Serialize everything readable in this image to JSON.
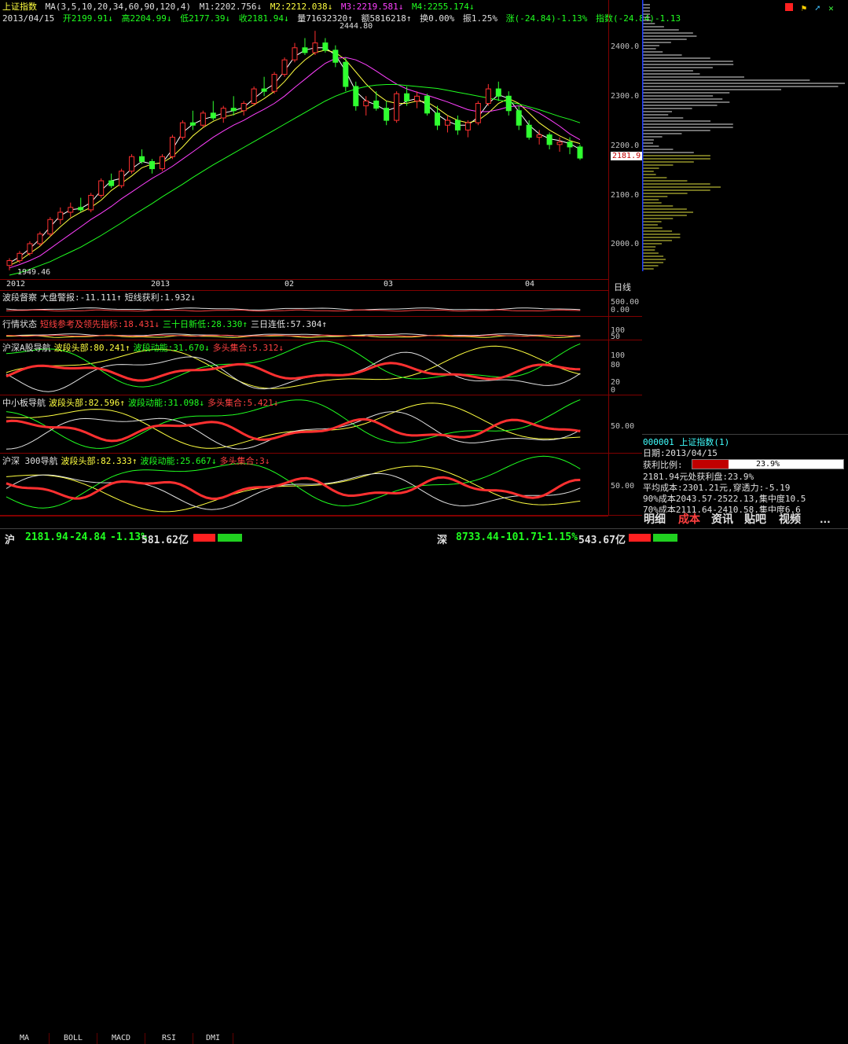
{
  "header": {
    "index_name": "上证指数",
    "ma_label": "MA(3,5,10,20,34,60,90,120,4)",
    "m1": "M1:2202.756↓",
    "m2": "M2:2212.038↓",
    "m3": "M3:2219.581↓",
    "m4": "M4:2255.174↓",
    "date": "2013/04/15",
    "open": "开2199.91↓",
    "high": "高2204.99↓",
    "low": "低2177.39↓",
    "close": "收2181.94↓",
    "volume": "量71632320↑",
    "amount": "额5816218↑",
    "turnover": "换0.00%",
    "amplitude": "振1.25%",
    "change": "涨(-24.84)-1.13%",
    "index_change": "指数(-24.84)-1.13"
  },
  "main_chart": {
    "high_label": "2444.80",
    "low_label": "1949.46",
    "price_ticks": [
      "2400.0",
      "2300.0",
      "2200.0",
      "2100.0",
      "2000.0"
    ],
    "current_price": "2181.9",
    "x_labels": [
      "2012",
      "2013",
      "02",
      "03",
      "04"
    ],
    "period": "日线"
  },
  "chart_data": {
    "type": "candlestick",
    "ylim": [
      1940,
      2460
    ],
    "ohlc": [
      [
        1960,
        1975,
        1950,
        1970
      ],
      [
        1970,
        1990,
        1965,
        1985
      ],
      [
        1985,
        2010,
        1980,
        2005
      ],
      [
        2005,
        2030,
        2000,
        2025
      ],
      [
        2025,
        2060,
        2020,
        2055
      ],
      [
        2055,
        2080,
        2045,
        2070
      ],
      [
        2070,
        2090,
        2060,
        2080
      ],
      [
        2080,
        2100,
        2070,
        2075
      ],
      [
        2075,
        2110,
        2070,
        2105
      ],
      [
        2105,
        2140,
        2100,
        2135
      ],
      [
        2135,
        2150,
        2120,
        2125
      ],
      [
        2125,
        2160,
        2120,
        2155
      ],
      [
        2155,
        2190,
        2150,
        2185
      ],
      [
        2185,
        2200,
        2170,
        2175
      ],
      [
        2175,
        2180,
        2150,
        2160
      ],
      [
        2160,
        2190,
        2155,
        2185
      ],
      [
        2185,
        2230,
        2180,
        2225
      ],
      [
        2225,
        2260,
        2220,
        2255
      ],
      [
        2255,
        2280,
        2240,
        2250
      ],
      [
        2250,
        2280,
        2245,
        2275
      ],
      [
        2275,
        2300,
        2260,
        2265
      ],
      [
        2265,
        2290,
        2255,
        2285
      ],
      [
        2285,
        2310,
        2270,
        2280
      ],
      [
        2280,
        2300,
        2270,
        2295
      ],
      [
        2295,
        2330,
        2290,
        2325
      ],
      [
        2325,
        2350,
        2310,
        2320
      ],
      [
        2320,
        2360,
        2315,
        2355
      ],
      [
        2355,
        2390,
        2350,
        2385
      ],
      [
        2385,
        2420,
        2380,
        2410
      ],
      [
        2410,
        2430,
        2395,
        2400
      ],
      [
        2400,
        2445,
        2395,
        2420
      ],
      [
        2420,
        2430,
        2400,
        2405
      ],
      [
        2405,
        2415,
        2370,
        2380
      ],
      [
        2380,
        2390,
        2320,
        2330
      ],
      [
        2330,
        2340,
        2280,
        2290
      ],
      [
        2290,
        2310,
        2270,
        2300
      ],
      [
        2300,
        2320,
        2280,
        2285
      ],
      [
        2285,
        2300,
        2250,
        2260
      ],
      [
        2260,
        2320,
        2255,
        2315
      ],
      [
        2315,
        2330,
        2290,
        2300
      ],
      [
        2300,
        2320,
        2285,
        2310
      ],
      [
        2310,
        2315,
        2270,
        2275
      ],
      [
        2275,
        2290,
        2240,
        2250
      ],
      [
        2250,
        2270,
        2235,
        2260
      ],
      [
        2260,
        2270,
        2230,
        2240
      ],
      [
        2240,
        2260,
        2225,
        2255
      ],
      [
        2255,
        2300,
        2250,
        2295
      ],
      [
        2295,
        2335,
        2290,
        2325
      ],
      [
        2325,
        2340,
        2300,
        2310
      ],
      [
        2310,
        2320,
        2270,
        2280
      ],
      [
        2280,
        2290,
        2240,
        2250
      ],
      [
        2250,
        2260,
        2220,
        2225
      ],
      [
        2225,
        2240,
        2210,
        2230
      ],
      [
        2230,
        2235,
        2200,
        2210
      ],
      [
        2210,
        2225,
        2195,
        2215
      ],
      [
        2215,
        2225,
        2190,
        2205
      ],
      [
        2205,
        2210,
        2178,
        2182
      ]
    ],
    "ma_lines": [
      {
        "name": "M1",
        "color": "#ffffff",
        "values": [
          1965,
          1978,
          1995,
          2015,
          2040,
          2063,
          2075,
          2078,
          2090,
          2115,
          2135,
          2140,
          2160,
          2175,
          2170,
          2172,
          2200,
          2235,
          2252,
          2262,
          2268,
          2275,
          2280,
          2287,
          2305,
          2322,
          2335,
          2362,
          2392,
          2405,
          2410,
          2410,
          2395,
          2362,
          2320,
          2300,
          2292,
          2280,
          2287,
          2300,
          2305,
          2292,
          2272,
          2258,
          2250,
          2250,
          2267,
          2295,
          2313,
          2305,
          2278,
          2250,
          2232,
          2222,
          2218,
          2212,
          2200
        ]
      },
      {
        "name": "M2",
        "color": "#ffff40",
        "values": [
          1960,
          1970,
          1985,
          2000,
          2020,
          2040,
          2058,
          2070,
          2080,
          2095,
          2115,
          2130,
          2145,
          2162,
          2170,
          2172,
          2185,
          2205,
          2228,
          2245,
          2258,
          2267,
          2272,
          2280,
          2292,
          2305,
          2320,
          2340,
          2365,
          2385,
          2400,
          2405,
          2400,
          2385,
          2360,
          2335,
          2315,
          2300,
          2295,
          2295,
          2300,
          2298,
          2285,
          2270,
          2260,
          2255,
          2260,
          2275,
          2295,
          2305,
          2295,
          2275,
          2255,
          2240,
          2228,
          2218,
          2212
        ]
      },
      {
        "name": "M3",
        "color": "#ff40ff",
        "values": [
          1955,
          1962,
          1970,
          1980,
          1995,
          2010,
          2025,
          2040,
          2055,
          2068,
          2082,
          2098,
          2112,
          2126,
          2140,
          2152,
          2165,
          2180,
          2195,
          2210,
          2225,
          2238,
          2250,
          2260,
          2272,
          2283,
          2295,
          2310,
          2328,
          2345,
          2362,
          2378,
          2388,
          2390,
          2385,
          2375,
          2362,
          2348,
          2335,
          2325,
          2318,
          2312,
          2305,
          2298,
          2290,
          2282,
          2278,
          2278,
          2282,
          2288,
          2290,
          2285,
          2275,
          2262,
          2248,
          2232,
          2220
        ]
      },
      {
        "name": "M4",
        "color": "#20ff20",
        "values": [
          1940,
          1945,
          1952,
          1960,
          1968,
          1978,
          1988,
          1998,
          2010,
          2022,
          2035,
          2048,
          2062,
          2075,
          2088,
          2102,
          2115,
          2128,
          2142,
          2155,
          2168,
          2180,
          2192,
          2204,
          2216,
          2228,
          2240,
          2252,
          2264,
          2276,
          2288,
          2300,
          2310,
          2318,
          2325,
          2330,
          2333,
          2334,
          2334,
          2332,
          2330,
          2328,
          2326,
          2322,
          2318,
          2314,
          2310,
          2306,
          2302,
          2298,
          2294,
          2288,
          2282,
          2275,
          2268,
          2262,
          2255
        ]
      }
    ]
  },
  "sub_panels": [
    {
      "title": "波段督察",
      "items": [
        {
          "text": "大盘警报:-11.111↑",
          "color": "#e0e0e0"
        },
        {
          "text": "短线获利:1.932↓",
          "color": "#e0e0e0"
        }
      ],
      "ticks": [
        "500.00",
        "0.00"
      ]
    },
    {
      "title": "行情状态",
      "items": [
        {
          "text": "短线参考及领先指标:18.431↓",
          "color": "#ff4040"
        },
        {
          "text": "三十日新低:28.330↑",
          "color": "#20ff20"
        },
        {
          "text": "三日连低:57.304↑",
          "color": "#e0e0e0"
        }
      ],
      "ticks": [
        "100",
        "50"
      ]
    },
    {
      "title": "沪深A股导航",
      "items": [
        {
          "text": "波段头部:80.241↑",
          "color": "#ffff40"
        },
        {
          "text": "波段动能:31.670↓",
          "color": "#20ff20"
        },
        {
          "text": "多头集合:5.312↓",
          "color": "#ff4040"
        }
      ],
      "ticks": [
        "100",
        "80",
        "20",
        "0"
      ]
    },
    {
      "title": "中小板导航",
      "items": [
        {
          "text": "波段头部:82.596↑",
          "color": "#ffff40"
        },
        {
          "text": "波段动能:31.098↓",
          "color": "#20ff20"
        },
        {
          "text": "多头集合:5.421↓",
          "color": "#ff4040"
        }
      ],
      "ticks": [
        "50.00"
      ]
    },
    {
      "title": "沪深 300导航",
      "items": [
        {
          "text": "波段头部:82.333↑",
          "color": "#ffff40"
        },
        {
          "text": "波段动能:25.667↓",
          "color": "#20ff20"
        },
        {
          "text": "多头集合:3↓",
          "color": "#ff4040"
        }
      ],
      "ticks": [
        "50.00"
      ]
    }
  ],
  "bottom_tabs": [
    "MA",
    "BOLL",
    "MACD",
    "RSI",
    "DMI"
  ],
  "right_panel": {
    "code_line": "000001 上证指数(1)",
    "date_line": "日期:2013/04/15",
    "profit_ratio_label": "获利比例:",
    "profit_ratio_value": "23.9%",
    "profit_fraction": 0.239,
    "line1": "2181.94元处获利盘:23.9%",
    "line2": "平均成本:2301.21元,穿透力:-5.19",
    "line3": "90%成本2043.57-2522.13,集中度10.5",
    "line4": "70%成本2111.64-2410.58,集中度6.6",
    "tabs": [
      "明细",
      "成本",
      "资讯",
      "贴吧",
      "视频",
      "..."
    ]
  },
  "status_bar": {
    "sh_label": "沪",
    "sh_value": "2181.94",
    "sh_change": "-24.84",
    "sh_pct": "-1.13%",
    "sh_amount": "581.62亿",
    "sz_label": "深",
    "sz_value": "8733.44",
    "sz_change": "-101.71",
    "sz_pct": "-1.15%",
    "sz_amount": "543.67亿"
  }
}
